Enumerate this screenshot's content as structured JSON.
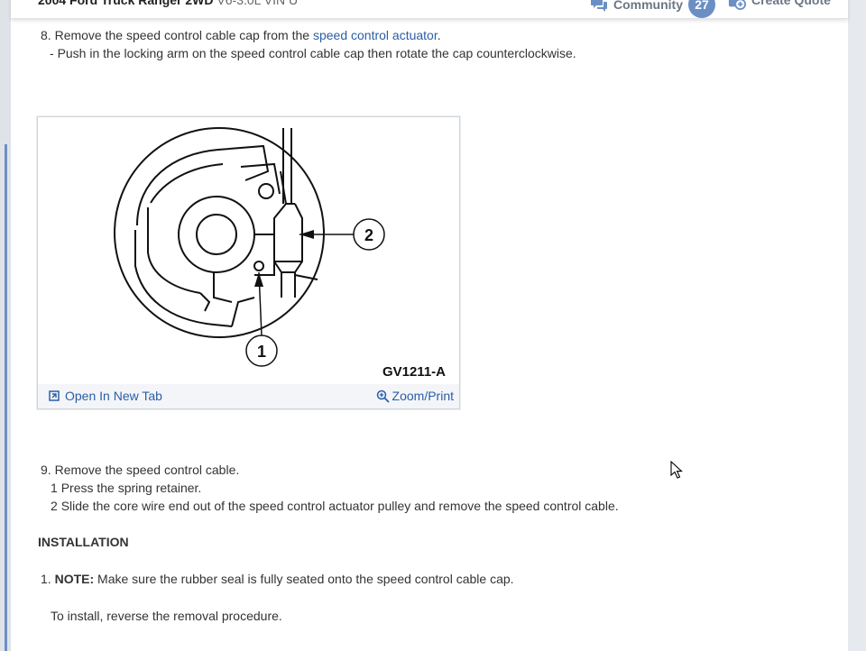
{
  "header": {
    "vehicle_name": "2004 Ford Truck Ranger 2WD",
    "engine": "V6-3.0L VIN U",
    "community_label": "Community",
    "community_count": "27",
    "create_quote_label": "Create Quote",
    "accent_color": "#6b8fc4"
  },
  "step8": {
    "number": "8.",
    "text_before": "Remove the speed control cable cap from the",
    "link_text": "speed control actuator",
    "text_after": ".",
    "sub_bullet": "-",
    "sub_text": "Push in the locking arm on the speed control cable cap then rotate the cap counterclockwise."
  },
  "figure": {
    "callout_1": "1",
    "callout_2": "2",
    "code": "GV1211-A",
    "open_new_tab": "Open In New Tab",
    "zoom_print": "Zoom/Print"
  },
  "step9": {
    "number": "9.",
    "text": "Remove the speed control cable.",
    "sub1_num": "1",
    "sub1_text": "Press the spring retainer.",
    "sub2_num": "2",
    "sub2_text": "Slide the core wire end out of the speed control actuator pulley and remove the speed control cable."
  },
  "installation": {
    "heading": "INSTALLATION",
    "step1_num": "1.",
    "note_label": "NOTE:",
    "note_text": "Make sure the rubber seal is fully seated onto the speed control cable cap.",
    "reverse_text": "To install, reverse the removal procedure."
  }
}
